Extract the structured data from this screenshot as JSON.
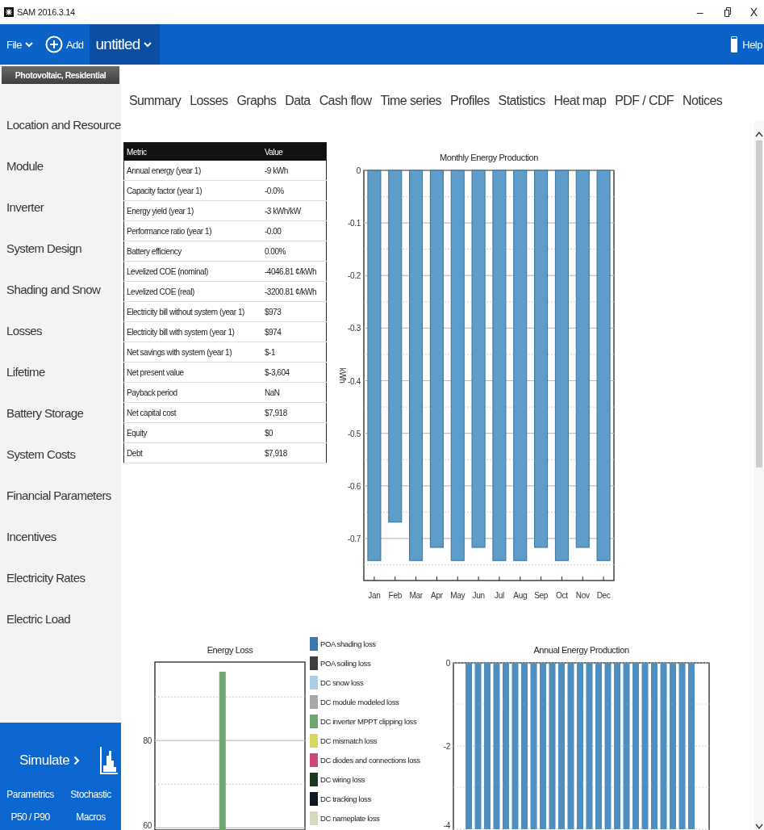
{
  "window": {
    "title": "SAM 2016.3.14",
    "minimize": "–",
    "close": "X"
  },
  "toolbar": {
    "file_menu": "File",
    "add_button": "Add",
    "project_tab": "untitled",
    "help_button": "Help"
  },
  "sidebar": {
    "configuration": "Photovoltaic, Residential",
    "items": [
      "Location and Resource",
      "Module",
      "Inverter",
      "System Design",
      "Shading and Snow",
      "Losses",
      "Lifetime",
      "Battery Storage",
      "System Costs",
      "Financial Parameters",
      "Incentives",
      "Electricity Rates",
      "Electric Load"
    ],
    "simulate_button": "Simulate",
    "links": [
      "Parametrics",
      "Stochastic",
      "P50 / P90",
      "Macros"
    ]
  },
  "tabs": [
    "Summary",
    "Losses",
    "Graphs",
    "Data",
    "Cash flow",
    "Time series",
    "Profiles",
    "Statistics",
    "Heat map",
    "PDF / CDF",
    "Notices"
  ],
  "summary_table": {
    "columns": [
      "Metric",
      "Value"
    ],
    "rows": [
      [
        "Annual energy (year 1)",
        "-9 kWh"
      ],
      [
        "Capacity factor (year 1)",
        "-0.0%"
      ],
      [
        "Energy yield (year 1)",
        "-3 kWh/kW"
      ],
      [
        "Performance ratio (year 1)",
        "-0.00"
      ],
      [
        "Battery efficiency",
        "0.00%"
      ],
      [
        "Levelized COE (nominal)",
        "-4046.81 ¢/kWh"
      ],
      [
        "Levelized COE (real)",
        "-3200.81 ¢/kWh"
      ],
      [
        "Electricity bill without system (year 1)",
        "$973"
      ],
      [
        "Electricity bill with system (year 1)",
        "$974"
      ],
      [
        "Net savings with system (year 1)",
        "$-1"
      ],
      [
        "Net present value",
        "$-3,604"
      ],
      [
        "Payback period",
        "NaN"
      ],
      [
        "Net capital cost",
        "$7,918"
      ],
      [
        "Equity",
        "$0"
      ],
      [
        "Debt",
        "$7,918"
      ]
    ]
  },
  "monthly_chart": {
    "chart_data": {
      "type": "bar",
      "title": "Monthly Energy Production",
      "ylabel": "kWh",
      "categories": [
        "Jan",
        "Feb",
        "Mar",
        "Apr",
        "May",
        "Jun",
        "Jul",
        "Aug",
        "Sep",
        "Oct",
        "Nov",
        "Dec"
      ],
      "values": [
        -0.742,
        -0.669,
        -0.742,
        -0.717,
        -0.742,
        -0.717,
        -0.742,
        -0.742,
        -0.717,
        -0.742,
        -0.717,
        -0.742
      ],
      "ylim": [
        -0.78,
        0
      ],
      "yticks": [
        0,
        -0.1,
        -0.2,
        -0.3,
        -0.4,
        -0.5,
        -0.6,
        -0.7
      ],
      "grid": true
    }
  },
  "loss_chart": {
    "chart_data": {
      "type": "bar",
      "title": "Energy Loss",
      "ylim": [
        59.5,
        98
      ],
      "yticks": [
        60,
        80
      ],
      "grid": true,
      "series": [
        {
          "name": "POA shading loss",
          "color": "#3a78b0",
          "values": [
            null
          ]
        },
        {
          "name": "POA soiling loss",
          "color": "#404040",
          "values": [
            null
          ]
        },
        {
          "name": "DC snow loss",
          "color": "#a9cfe8",
          "values": [
            null
          ]
        },
        {
          "name": "DC module modeled loss",
          "color": "#a8a8a8",
          "values": [
            null
          ]
        },
        {
          "name": "DC inverter MPPT clipping loss",
          "color": "#6fa66f",
          "values": [
            95.7
          ]
        },
        {
          "name": "DC mismatch loss",
          "color": "#d8d860",
          "values": [
            null
          ]
        },
        {
          "name": "DC diodes and connections loss",
          "color": "#d0457a",
          "values": [
            null
          ]
        },
        {
          "name": "DC wiring loss",
          "color": "#1c3a1c",
          "values": [
            null
          ]
        },
        {
          "name": "DC tracking loss",
          "color": "#101820",
          "values": [
            null
          ]
        },
        {
          "name": "DC nameplate loss",
          "color": "#d8d8c0",
          "values": [
            null
          ]
        }
      ]
    }
  },
  "annual_chart": {
    "title": "Annual Energy Production",
    "axis_labels": [
      "0",
      "-2",
      "-4"
    ]
  }
}
